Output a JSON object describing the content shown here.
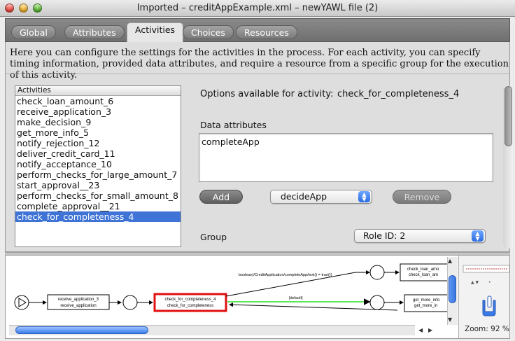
{
  "window": {
    "title": "Imported – creditAppExample.xml – newYAWL file (2)"
  },
  "tabs": [
    {
      "label": "Global",
      "active": false
    },
    {
      "label": "Attributes",
      "active": false
    },
    {
      "label": "Activities",
      "active": true
    },
    {
      "label": "Choices",
      "active": false
    },
    {
      "label": "Resources",
      "active": false
    }
  ],
  "description": "Here you can configure the settings for the activities in the process. For each activity, you can specify timing information, provided data attributes, and require a resource from a specific group for the execution of this activity.",
  "activities": {
    "header": "Activities",
    "items": [
      "check_loan_amount_6",
      "receive_application_3",
      "make_decision_9",
      "get_more_info_5",
      "notify_rejection_12",
      "deliver_credit_card_11",
      "notify_acceptance_10",
      "perform_checks_for_large_amount_7",
      "start_approval__23",
      "perform_checks_for_small_amount_8",
      "complete_approval__21",
      "check_for_completeness_4"
    ],
    "selected": "check_for_completeness_4"
  },
  "options": {
    "label": "Options available for activity:",
    "value": "check_for_completeness_4",
    "data_attributes_label": "Data attributes",
    "data_attributes": [
      "completeApp"
    ],
    "add_label": "Add",
    "attribute_select": "decideApp",
    "remove_label": "Remove",
    "group_label": "Group",
    "group_select": "Role ID: 2"
  },
  "graph": {
    "condition_label": "boolean(/CreditApplication/completeApp/text() = true())",
    "default_label": "[default]",
    "task_receive": [
      "receive_application_3",
      "receive_application"
    ],
    "task_check": [
      "check_for_completeness_4",
      "check_for_completeness"
    ],
    "task_loan": [
      "check_loan_amo",
      "check_loan_am"
    ],
    "task_more": [
      "get_more_info",
      "get_more_in"
    ],
    "zoom": "Zoom: 92 %"
  },
  "colors": {
    "selection": "#3f74d6",
    "highlight_task": "#e01010",
    "default_flow": "#22dd22"
  }
}
